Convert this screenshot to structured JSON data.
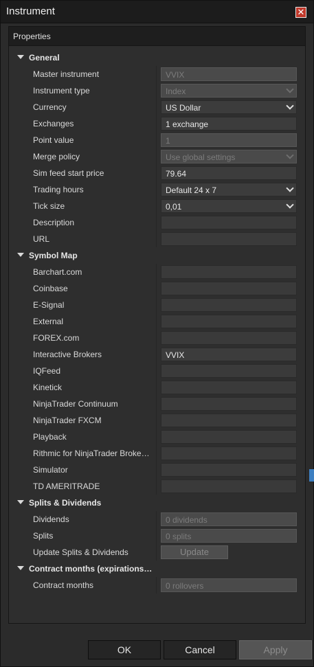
{
  "window": {
    "title": "Instrument",
    "close_glyph": "✕"
  },
  "panel": {
    "header": "Properties"
  },
  "sections": [
    {
      "title": "General",
      "rows": [
        {
          "label": "Master instrument",
          "value": "VVIX",
          "state": "disabled",
          "dropdown": false
        },
        {
          "label": "Instrument type",
          "value": "Index",
          "state": "disabled",
          "dropdown": true
        },
        {
          "label": "Currency",
          "value": "US Dollar",
          "state": "enabled",
          "dropdown": true
        },
        {
          "label": "Exchanges",
          "value": "1 exchange",
          "state": "enabled",
          "dropdown": false
        },
        {
          "label": "Point value",
          "value": "1",
          "state": "disabled",
          "dropdown": false
        },
        {
          "label": "Merge policy",
          "value": "Use global settings",
          "state": "disabled",
          "dropdown": true
        },
        {
          "label": "Sim feed start price",
          "value": "79.64",
          "state": "enabled",
          "dropdown": false
        },
        {
          "label": "Trading hours",
          "value": "Default 24 x 7",
          "state": "enabled",
          "dropdown": true
        },
        {
          "label": "Tick size",
          "value": "0,01",
          "state": "enabled",
          "dropdown": true
        },
        {
          "label": "Description",
          "value": "",
          "state": "enabled",
          "dropdown": false
        },
        {
          "label": "URL",
          "value": "",
          "state": "enabled",
          "dropdown": false
        }
      ]
    },
    {
      "title": "Symbol Map",
      "rows": [
        {
          "label": "Barchart.com",
          "value": "",
          "state": "enabled",
          "dropdown": false
        },
        {
          "label": "Coinbase",
          "value": "",
          "state": "enabled",
          "dropdown": false
        },
        {
          "label": "E-Signal",
          "value": "",
          "state": "enabled",
          "dropdown": false
        },
        {
          "label": "External",
          "value": "",
          "state": "enabled",
          "dropdown": false
        },
        {
          "label": "FOREX.com",
          "value": "",
          "state": "enabled",
          "dropdown": false
        },
        {
          "label": "Interactive Brokers",
          "value": "VVIX",
          "state": "enabled",
          "dropdown": false
        },
        {
          "label": "IQFeed",
          "value": "",
          "state": "enabled",
          "dropdown": false
        },
        {
          "label": "Kinetick",
          "value": "",
          "state": "enabled",
          "dropdown": false
        },
        {
          "label": "NinjaTrader Continuum",
          "value": "",
          "state": "enabled",
          "dropdown": false
        },
        {
          "label": "NinjaTrader FXCM",
          "value": "",
          "state": "enabled",
          "dropdown": false
        },
        {
          "label": "Playback",
          "value": "",
          "state": "enabled",
          "dropdown": false
        },
        {
          "label": "Rithmic for NinjaTrader Broke…",
          "value": "",
          "state": "enabled",
          "dropdown": false
        },
        {
          "label": "Simulator",
          "value": "",
          "state": "enabled",
          "dropdown": false
        },
        {
          "label": "TD AMERITRADE",
          "value": "",
          "state": "enabled",
          "dropdown": false
        }
      ]
    },
    {
      "title": "Splits & Dividends",
      "rows": [
        {
          "label": "Dividends",
          "value": "0 dividends",
          "state": "disabled",
          "dropdown": false
        },
        {
          "label": "Splits",
          "value": "0 splits",
          "state": "disabled",
          "dropdown": false
        },
        {
          "label": "Update Splits & Dividends",
          "value": "Update",
          "state": "button",
          "dropdown": false
        }
      ]
    },
    {
      "title": "Contract months (expirations…",
      "rows": [
        {
          "label": "Contract months",
          "value": "0 rollovers",
          "state": "disabled",
          "dropdown": false
        }
      ]
    }
  ],
  "footer": {
    "ok": "OK",
    "cancel": "Cancel",
    "apply": "Apply"
  },
  "colors": {
    "background": "#2b2b2b",
    "close": "#c0392b",
    "field": "#3c3c3c",
    "field_disabled": "#4a4a4a"
  }
}
